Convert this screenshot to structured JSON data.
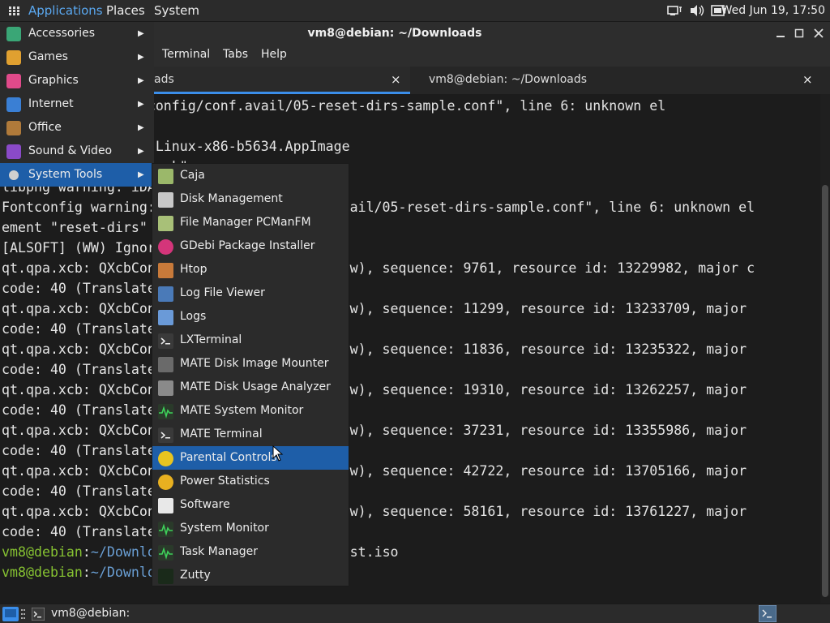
{
  "top_panel": {
    "applications": "Applications",
    "places": "Places",
    "system": "System",
    "clock": "Wed Jun 19, 17:50",
    "icons": [
      "network-icon",
      "volume-icon",
      "battery-icon"
    ]
  },
  "window": {
    "title": "vm8@debian: ~/Downloads",
    "menus": [
      "Terminal",
      "Tabs",
      "Help"
    ],
    "tabs": [
      {
        "label": "ads",
        "close": "×"
      },
      {
        "label": "vm8@debian: ~/Downloads",
        "close": "×"
      }
    ]
  },
  "terminal": {
    "lines": [
      [
        {
          "t": "  \"/usr/share/fontconfig/conf.avail/05-reset-dirs-sample.conf\", line 6: unknown el",
          "c": ""
        }
      ],
      [
        {
          "t": "",
          "c": ""
        }
      ],
      [
        {
          "t": "      ads",
          "c": "blue"
        },
        {
          "t": "$ ./86Box-Linux-x86-b5634.AppImage",
          "c": ""
        }
      ],
      [
        {
          "t": "                    ok\"",
          "c": ""
        }
      ],
      [
        {
          "t": "libpng warning: iDA",
          "c": ""
        }
      ],
      [
        {
          "t": "Fontconfig warning:                 conf.avail/05-reset-dirs-sample.conf\", line 6: unknown el",
          "c": ""
        }
      ],
      [
        {
          "t": "ement \"reset-dirs\"",
          "c": ""
        }
      ],
      [
        {
          "t": "[ALSOFT] (WW) Ignor",
          "c": ""
        }
      ],
      [
        {
          "t": "qt.qpa.xcb: QXcbCon                 adWindow), sequence: 9761, resource id: 13229982, major c",
          "c": ""
        }
      ],
      [
        {
          "t": "code: 40 (Translate(",
          "c": ""
        }
      ],
      [
        {
          "t": "qt.qpa.xcb: QXcbCon                 adWindow), sequence: 11299, resource id: 13233709, major",
          "c": ""
        }
      ],
      [
        {
          "t": "code: 40 (Translate",
          "c": ""
        }
      ],
      [
        {
          "t": "qt.qpa.xcb: QXcbCon                 adWindow), sequence: 11836, resource id: 13235322, major",
          "c": ""
        }
      ],
      [
        {
          "t": "code: 40 (Translate",
          "c": ""
        }
      ],
      [
        {
          "t": "qt.qpa.xcb: QXcbCon                 adWindow), sequence: 19310, resource id: 13262257, major",
          "c": ""
        }
      ],
      [
        {
          "t": "code: 40 (Translate",
          "c": ""
        }
      ],
      [
        {
          "t": "qt.qpa.xcb: QXcbCon                 adWindow), sequence: 37231, resource id: 13355986, major",
          "c": ""
        }
      ],
      [
        {
          "t": "code: 40 (Translate",
          "c": ""
        }
      ],
      [
        {
          "t": "qt.qpa.xcb: QXcbCon                 adWindow), sequence: 42722, resource id: 13705166, major",
          "c": ""
        }
      ],
      [
        {
          "t": "code: 40 (Translate",
          "c": ""
        }
      ],
      [
        {
          "t": "qt.qpa.xcb: QXcbCon                 adWindow), sequence: 58161, resource id: 13761227, major",
          "c": ""
        }
      ],
      [
        {
          "t": "code: 40 (Translate",
          "c": ""
        }
      ],
      [
        {
          "t": "vm8@debian",
          "c": "green"
        },
        {
          "t": ":",
          "c": ""
        },
        {
          "t": "~/Downlo",
          "c": "blue"
        },
        {
          "t": "                86-netinst.iso",
          "c": ""
        }
      ],
      [
        {
          "t": "vm8@debian",
          "c": "green"
        },
        {
          "t": ":",
          "c": ""
        },
        {
          "t": "~/Downlo",
          "c": "blue"
        }
      ]
    ]
  },
  "apps_menu": {
    "categories": [
      {
        "label": "Accessories",
        "icon": "accessories-icon",
        "color": "#3aa676"
      },
      {
        "label": "Games",
        "icon": "games-icon",
        "color": "#e0a030"
      },
      {
        "label": "Graphics",
        "icon": "graphics-icon",
        "color": "#e04a8a"
      },
      {
        "label": "Internet",
        "icon": "internet-icon",
        "color": "#3a7fd4"
      },
      {
        "label": "Office",
        "icon": "office-icon",
        "color": "#b07a3a"
      },
      {
        "label": "Sound & Video",
        "icon": "sound-video-icon",
        "color": "#8a4ac8"
      },
      {
        "label": "System Tools",
        "icon": "system-tools-icon",
        "color": "#cfcfcf",
        "active": true
      }
    ],
    "arrow": "▶"
  },
  "system_tools": {
    "items": [
      {
        "label": "Caja",
        "icon": "caja-icon",
        "color": "#9bb86a"
      },
      {
        "label": "Disk Management",
        "icon": "disk-management-icon",
        "color": "#c8c8c8"
      },
      {
        "label": "File Manager PCManFM",
        "icon": "file-manager-icon",
        "color": "#a8c078"
      },
      {
        "label": "GDebi Package Installer",
        "icon": "gdebi-icon",
        "color": "#d4357a"
      },
      {
        "label": "Htop",
        "icon": "htop-icon",
        "color": "#c87a3a"
      },
      {
        "label": "Log File Viewer",
        "icon": "log-viewer-icon",
        "color": "#4a7ab8"
      },
      {
        "label": "Logs",
        "icon": "logs-icon",
        "color": "#6a9ad8"
      },
      {
        "label": "LXTerminal",
        "icon": "lxterminal-icon",
        "color": "#3a3a3a"
      },
      {
        "label": "MATE Disk Image Mounter",
        "icon": "disk-image-mounter-icon",
        "color": "#6a6a6a"
      },
      {
        "label": "MATE Disk Usage Analyzer",
        "icon": "disk-usage-icon",
        "color": "#8a8a8a"
      },
      {
        "label": "MATE System Monitor",
        "icon": "system-monitor-icon",
        "color": "#2a3a2a"
      },
      {
        "label": "MATE Terminal",
        "icon": "mate-terminal-icon",
        "color": "#3a3a3a"
      },
      {
        "label": "Parental Controls",
        "icon": "parental-controls-icon",
        "color": "#e8c420",
        "active": true
      },
      {
        "label": "Power Statistics",
        "icon": "power-statistics-icon",
        "color": "#e8b020"
      },
      {
        "label": "Software",
        "icon": "software-icon",
        "color": "#e8e8e8"
      },
      {
        "label": "System Monitor",
        "icon": "system-monitor2-icon",
        "color": "#2a3a2a"
      },
      {
        "label": "Task Manager",
        "icon": "task-manager-icon",
        "color": "#2a3a2a"
      },
      {
        "label": "Zutty",
        "icon": "zutty-icon",
        "color": "#1a2a1a"
      }
    ]
  },
  "bottom_panel": {
    "taskbar_label": "vm8@debian: ~/Dow..."
  },
  "colors": {
    "accent": "#1e5ea8",
    "prompt_user": "#86c232",
    "prompt_path": "#6a9fd4"
  }
}
